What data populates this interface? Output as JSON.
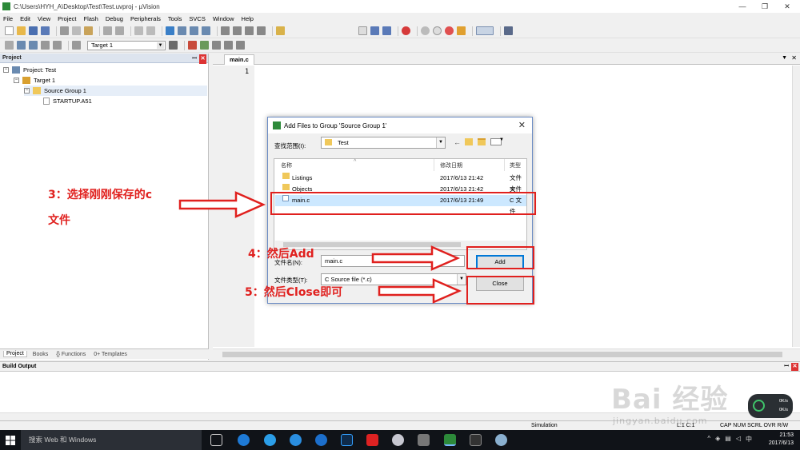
{
  "window": {
    "title": "C:\\Users\\HYH_A\\Desktop\\Test\\Test.uvproj - µVision"
  },
  "menu": [
    "File",
    "Edit",
    "View",
    "Project",
    "Flash",
    "Debug",
    "Peripherals",
    "Tools",
    "SVCS",
    "Window",
    "Help"
  ],
  "toolbar2": {
    "target_combo": "Target 1"
  },
  "project_panel": {
    "title": "Project",
    "tree": [
      {
        "label": "Project: Test",
        "level": 0
      },
      {
        "label": "Target 1",
        "level": 1
      },
      {
        "label": "Source Group 1",
        "level": 2
      },
      {
        "label": "STARTUP.A51",
        "level": 3
      }
    ],
    "tabs": [
      "Project",
      "Books",
      "{} Functions",
      "0+ Templates"
    ]
  },
  "editor": {
    "tab": "main.c",
    "line_number": "1"
  },
  "build_output": {
    "title": "Build Output"
  },
  "statusbar": {
    "mode": "Simulation",
    "pos": "L:1 C:1",
    "flags": "CAP  NUM  SCRL  OVR  R/W"
  },
  "dialog": {
    "title": "Add Files to Group 'Source Group 1'",
    "look_in_label": "查找范围(I):",
    "look_in_value": "Test",
    "columns": [
      "名称",
      "修改日期",
      "类型"
    ],
    "files": [
      {
        "name": "Listings",
        "date": "2017/6/13 21:42",
        "type": "文件夹"
      },
      {
        "name": "Objects",
        "date": "2017/6/13 21:42",
        "type": "文件夹"
      },
      {
        "name": "main.c",
        "date": "2017/6/13 21:49",
        "type": "C 文件"
      }
    ],
    "filename_label": "文件名(N):",
    "filename_value": "main.c",
    "filetype_label": "文件类型(T):",
    "filetype_value": "C Source file (*.c)",
    "add_button": "Add",
    "close_button": "Close"
  },
  "annotations": {
    "step3_line1": "3：选择刚刚保存的c",
    "step3_line2": "文件",
    "step4": "4：然后Add",
    "step5": "5：然后Close即可",
    "color": "#e0201e"
  },
  "taskbar": {
    "search_placeholder": "搜索 Web 和 Windows",
    "ime": "中",
    "time": "21:53",
    "date": "2017/6/13"
  },
  "watermark": {
    "brand": "Bai 经验",
    "url": "jingyan.baidu.com"
  },
  "net_widget": {
    "up": "0K/s",
    "down": "0K/s"
  }
}
